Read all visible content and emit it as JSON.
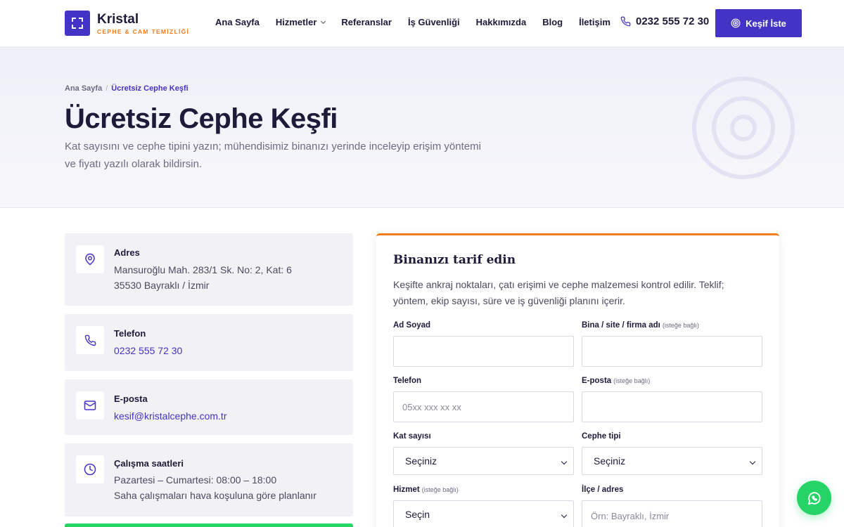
{
  "brand": {
    "name": "Kristal",
    "tagline": "CEPHE & CAM TEMİZLİĞİ",
    "accent": "#4334c6",
    "orange": "#f07c1e"
  },
  "nav": {
    "items": [
      "Ana Sayfa",
      "Hizmetler",
      "Referanslar",
      "İş Güvenliği",
      "Hakkımızda",
      "Blog",
      "İletişim"
    ]
  },
  "header": {
    "phone": "0232 555 72 30",
    "cta_label": "Keşif İste"
  },
  "hero": {
    "breadcrumb_home": "Ana Sayfa",
    "breadcrumb_sep": "/",
    "breadcrumb_current": "Ücretsiz Cephe Keşfi",
    "title": "Ücretsiz Cephe Keşfi",
    "subtitle": "Kat sayısını ve cephe tipini yazın; mühendisimiz binanızı yerinde inceleyip erişim yöntemi ve fiyatı yazılı olarak bildirsin."
  },
  "contact": {
    "address_title": "Adres",
    "address_line1": "Mansuroğlu Mah. 283/1 Sk. No: 2, Kat: 6",
    "address_line2": "35530 Bayraklı / İzmir",
    "phone_title": "Telefon",
    "phone_value": "0232 555 72 30",
    "email_title": "E-posta",
    "email_value": "kesif@kristalcephe.com.tr",
    "hours_title": "Çalışma saatleri",
    "hours_line1": "Pazartesi – Cumartesi: 08:00 – 18:00",
    "hours_line2": "Saha çalışmaları hava koşuluna göre planlanır"
  },
  "form": {
    "title": "Binanızı tarif edin",
    "description": "Keşifte ankraj noktaları, çatı erişimi ve cephe malzemesi kontrol edilir. Teklif; yöntem, ekip sayısı, süre ve iş güvenliği planını içerir.",
    "optional_note": "(isteğe bağlı)",
    "name_label": "Ad Soyad",
    "building_label": "Bina / site / firma adı",
    "phone_label": "Telefon",
    "phone_placeholder": "05xx xxx xx xx",
    "email_label": "E-posta",
    "floors_label": "Kat sayısı",
    "floors_value": "Seçiniz",
    "facade_label": "Cephe tipi",
    "facade_value": "Seçiniz",
    "service_label": "Hizmet",
    "service_value": "Seçin",
    "district_label": "İlçe / adres",
    "district_placeholder": "Örn: Bayraklı, İzmir"
  },
  "icons": [
    "location-pin-icon",
    "phone-icon",
    "mail-icon",
    "clock-icon",
    "target-icon",
    "whatsapp-icon"
  ]
}
